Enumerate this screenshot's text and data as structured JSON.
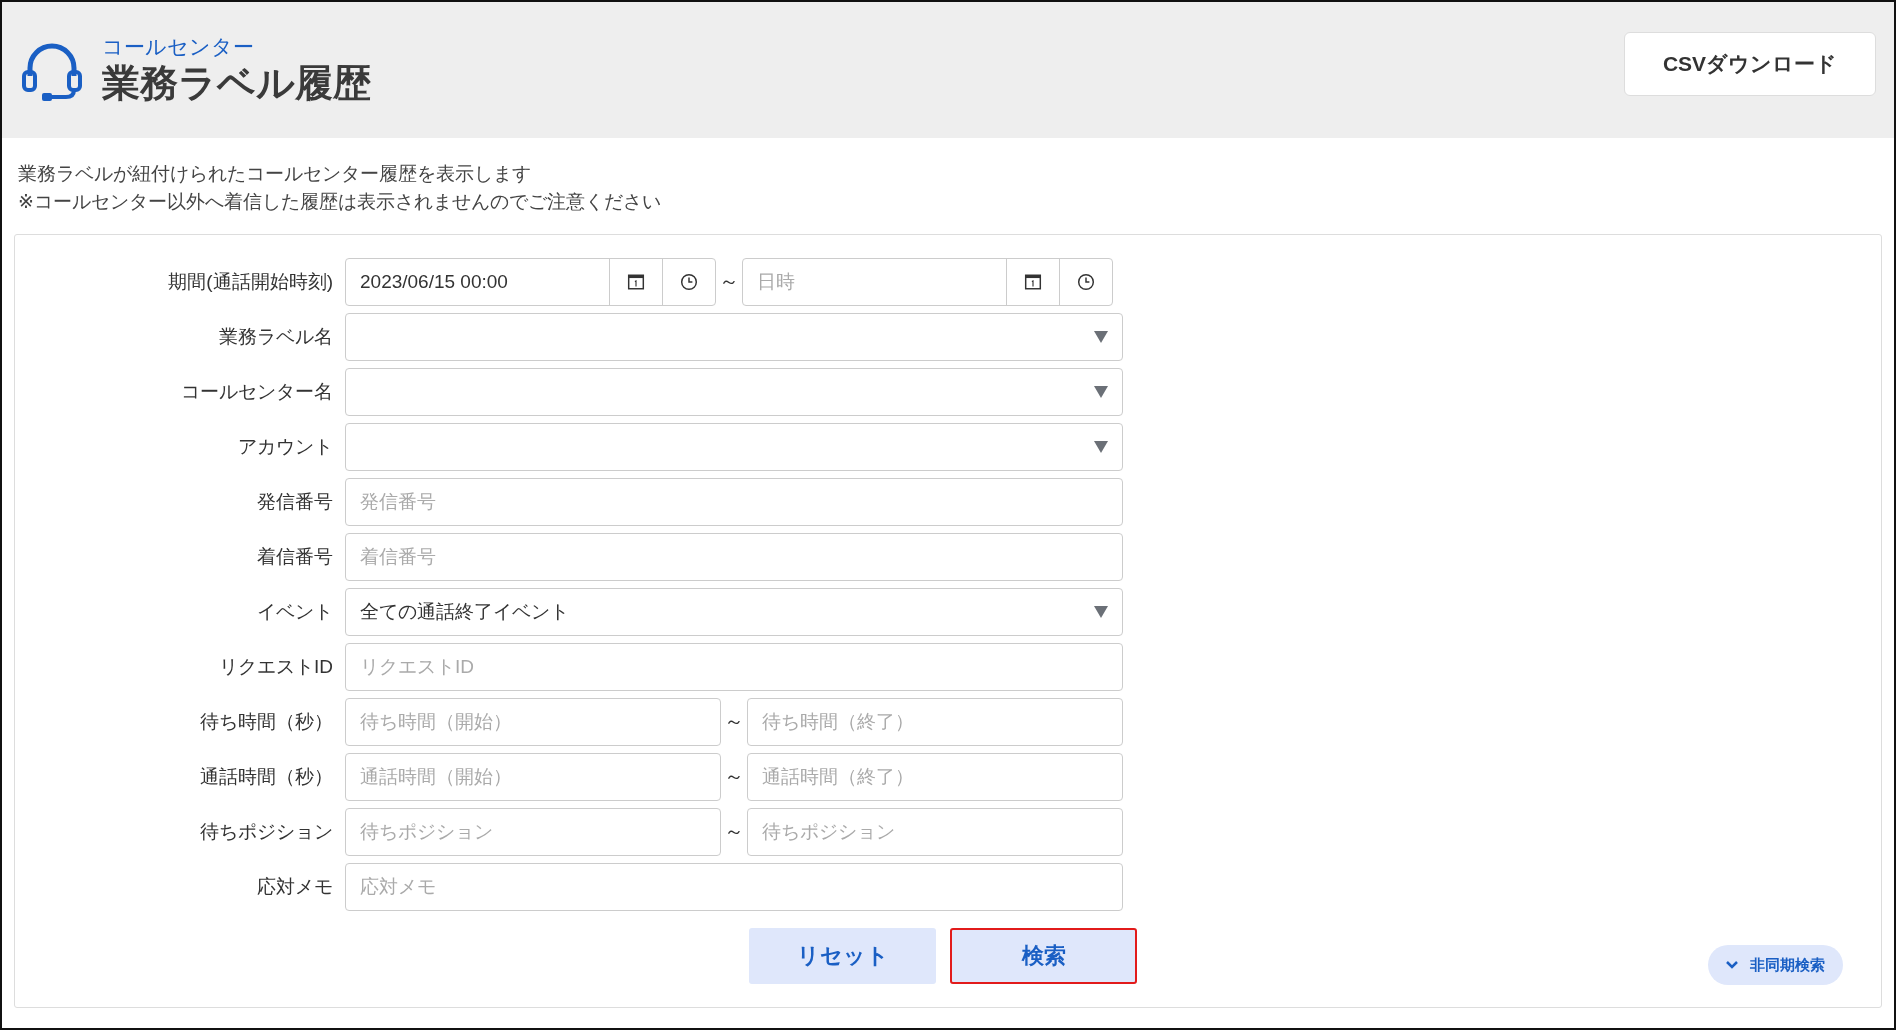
{
  "header": {
    "subtitle": "コールセンター",
    "title": "業務ラベル履歴",
    "csv_button": "CSVダウンロード"
  },
  "description": [
    "業務ラベルが紐付けられたコールセンター履歴を表示します",
    "※コールセンター以外へ着信した履歴は表示されませんのでご注意ください"
  ],
  "fields": [
    {
      "kind": "datetime-range",
      "label": "期間(通話開始時刻)",
      "from_value": "2023/06/15 00:00",
      "separator": "～",
      "to_placeholder": "日時"
    },
    {
      "kind": "select",
      "label": "業務ラベル名"
    },
    {
      "kind": "select",
      "label": "コールセンター名"
    },
    {
      "kind": "select",
      "label": "アカウント"
    },
    {
      "kind": "text",
      "label": "発信番号",
      "placeholder": "発信番号"
    },
    {
      "kind": "text",
      "label": "着信番号",
      "placeholder": "着信番号"
    },
    {
      "kind": "select",
      "label": "イベント",
      "value": "全ての通話終了イベント"
    },
    {
      "kind": "text",
      "label": "リクエストID",
      "placeholder": "リクエストID"
    },
    {
      "kind": "range",
      "label": "待ち時間（秒）",
      "from_placeholder": "待ち時間（開始）",
      "separator": "～",
      "to_placeholder": "待ち時間（終了）"
    },
    {
      "kind": "range",
      "label": "通話時間（秒）",
      "from_placeholder": "通話時間（開始）",
      "separator": "～",
      "to_placeholder": "通話時間（終了）"
    },
    {
      "kind": "range",
      "label": "待ちポジション",
      "from_placeholder": "待ちポジション",
      "separator": "～",
      "to_placeholder": "待ちポジション"
    },
    {
      "kind": "text",
      "label": "応対メモ",
      "placeholder": "応対メモ"
    }
  ],
  "buttons": [
    {
      "label": "リセット",
      "highlighted": false
    },
    {
      "label": "検索",
      "highlighted": true
    }
  ],
  "async_toggle": {
    "label": "非同期検索",
    "expanded": false
  }
}
